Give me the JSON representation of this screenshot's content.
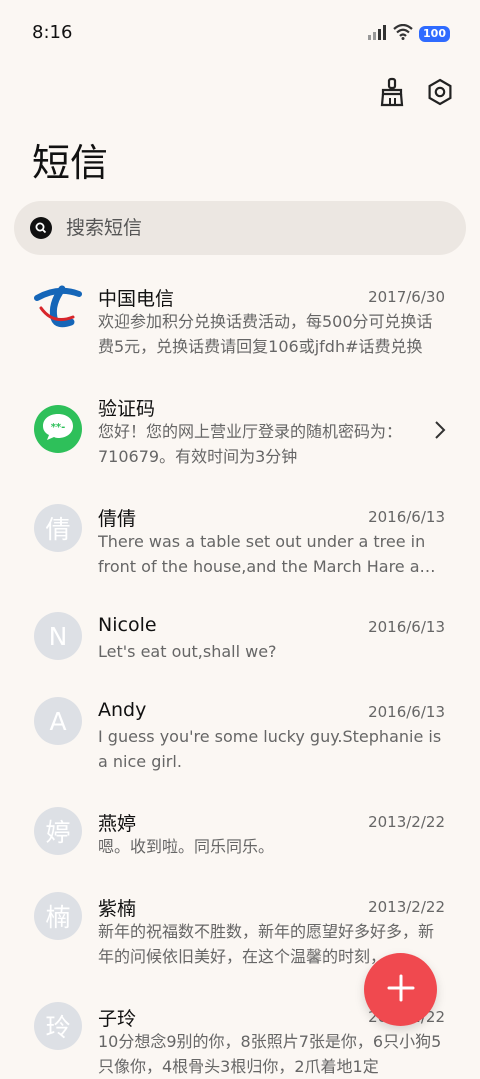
{
  "status_bar": {
    "time": "8:16",
    "battery": "100"
  },
  "page": {
    "title": "短信"
  },
  "search": {
    "placeholder": "搜索短信"
  },
  "messages": [
    {
      "sender": "中国电信",
      "date": "2017/6/30",
      "preview": "欢迎参加积分兑换话费活动，每500分可兑换话费5元，兑换话费请回复106或jfdh#话费兑换"
    },
    {
      "sender": "验证码",
      "date": "",
      "preview": "您好！您的网上营业厅登录的随机密码为：710679。有效时间为3分钟"
    },
    {
      "sender": "倩倩",
      "avatar": "倩",
      "date": "2016/6/13",
      "preview": "There was a table set out under a tree in front of the house,and the March Hare and the Hatter were having tea"
    },
    {
      "sender": "Nicole",
      "avatar": "N",
      "date": "2016/6/13",
      "preview": "Let's eat out,shall we?"
    },
    {
      "sender": "Andy",
      "avatar": "A",
      "date": "2016/6/13",
      "preview": "I guess you're some lucky guy.Stephanie is a nice girl."
    },
    {
      "sender": "燕婷",
      "avatar": "婷",
      "date": "2013/2/22",
      "preview": "嗯。收到啦。同乐同乐。"
    },
    {
      "sender": "紫楠",
      "avatar": "楠",
      "date": "2013/2/22",
      "preview": "新年的祝福数不胜数，新年的愿望好多好多，新年的问候依旧美好，在这个温馨的时刻，"
    },
    {
      "sender": "子玲",
      "avatar": "玲",
      "date": "2013/2/22",
      "preview": "10分想念9别的你，8张照片7张是你，6只小狗5只像你，4根骨头3根归你，2爪着地1定"
    }
  ],
  "colors": {
    "fab": "#f0494f",
    "background": "#fbf7f3",
    "battery": "#2f6bff"
  },
  "icons": {
    "toolbar": [
      "clean-brush-icon",
      "settings-icon"
    ],
    "fab": "plus-icon"
  }
}
